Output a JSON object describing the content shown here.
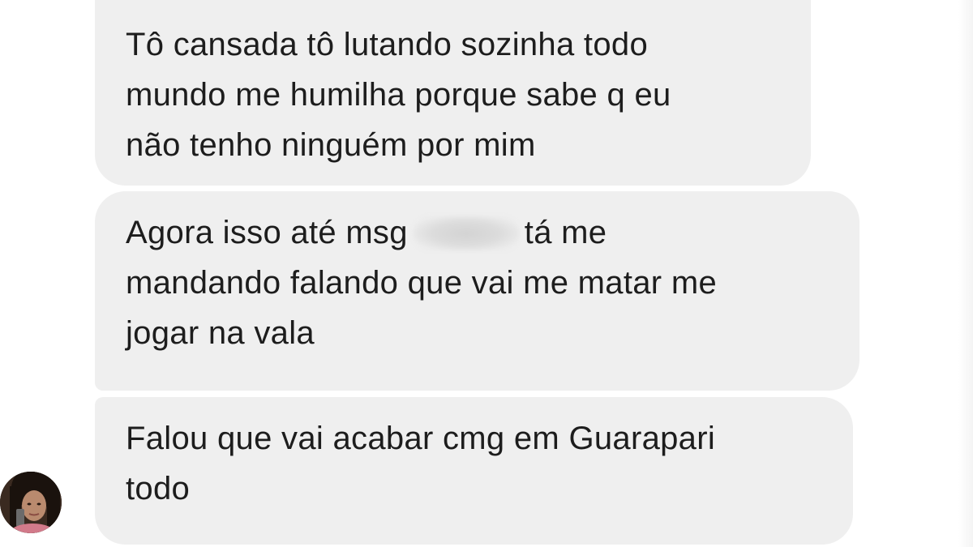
{
  "conversation": {
    "messages": [
      {
        "lines": [
          "Tô cansada tô lutando sozinha todo",
          "mundo me humilha porque sabe q eu",
          "não tenho ninguém por mim"
        ]
      },
      {
        "line1_before": "Agora isso até msg",
        "line1_after": "tá me",
        "lines": [
          "mandando falando que vai me matar me",
          "jogar na vala"
        ]
      },
      {
        "lines": [
          "Falou que vai acabar cmg em Guarapari",
          "todo"
        ]
      }
    ],
    "colors": {
      "bubble_background": "#efefef",
      "text": "#1d1d1d",
      "page_background": "#ffffff"
    },
    "avatar_icon": "profile-photo"
  }
}
